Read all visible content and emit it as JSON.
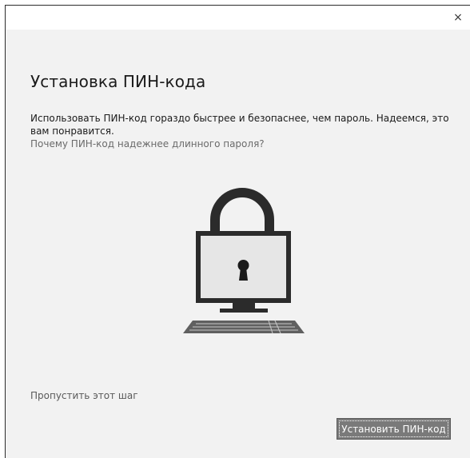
{
  "window": {
    "close_glyph": "×"
  },
  "content": {
    "title": "Установка ПИН-кода",
    "description": "Использовать ПИН-код гораздо быстрее и безопаснее, чем пароль. Надеемся, это вам понравится.",
    "help_link": "Почему ПИН-код надежнее длинного пароля?"
  },
  "illustration": {
    "icon": "lock-computer-icon",
    "colors": {
      "dark": "#2b2b2b",
      "screen": "#e6e6e6",
      "keyboard": "#606060"
    }
  },
  "footer": {
    "skip_link": "Пропустить этот шаг",
    "primary_button": "Установить ПИН-код"
  },
  "colors": {
    "background": "#f2f2f2",
    "titlebar": "#ffffff",
    "button_bg": "#7a7a7a",
    "link": "#6b6b6b"
  }
}
